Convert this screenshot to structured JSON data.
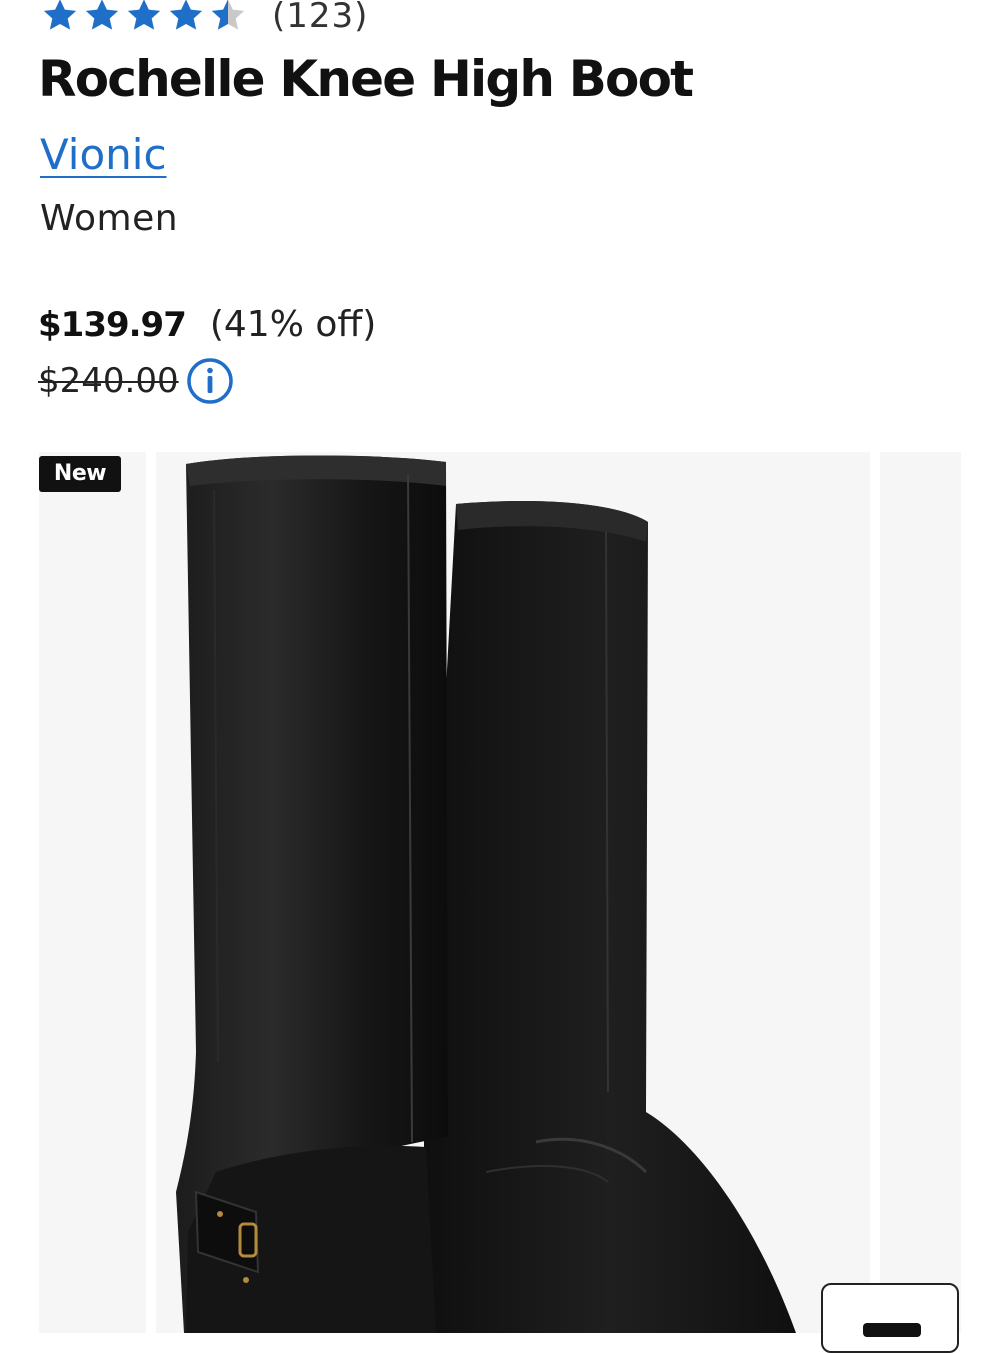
{
  "product": {
    "rating": {
      "value": 4.5,
      "max": 5,
      "count_label": "(123)",
      "star_color": "#1f6fc9"
    },
    "title": "Rochelle Knee High Boot",
    "brand": "Vionic",
    "gender": "Women",
    "price": {
      "sale": "$139.97",
      "discount": "(41% off)",
      "original": "$240.00"
    },
    "badge": "New"
  },
  "icons": {
    "rating": "star-icon",
    "info": "info-icon"
  },
  "colors": {
    "accent": "#1f6fc9",
    "text": "#111111",
    "image_bg": "#f6f6f6"
  }
}
